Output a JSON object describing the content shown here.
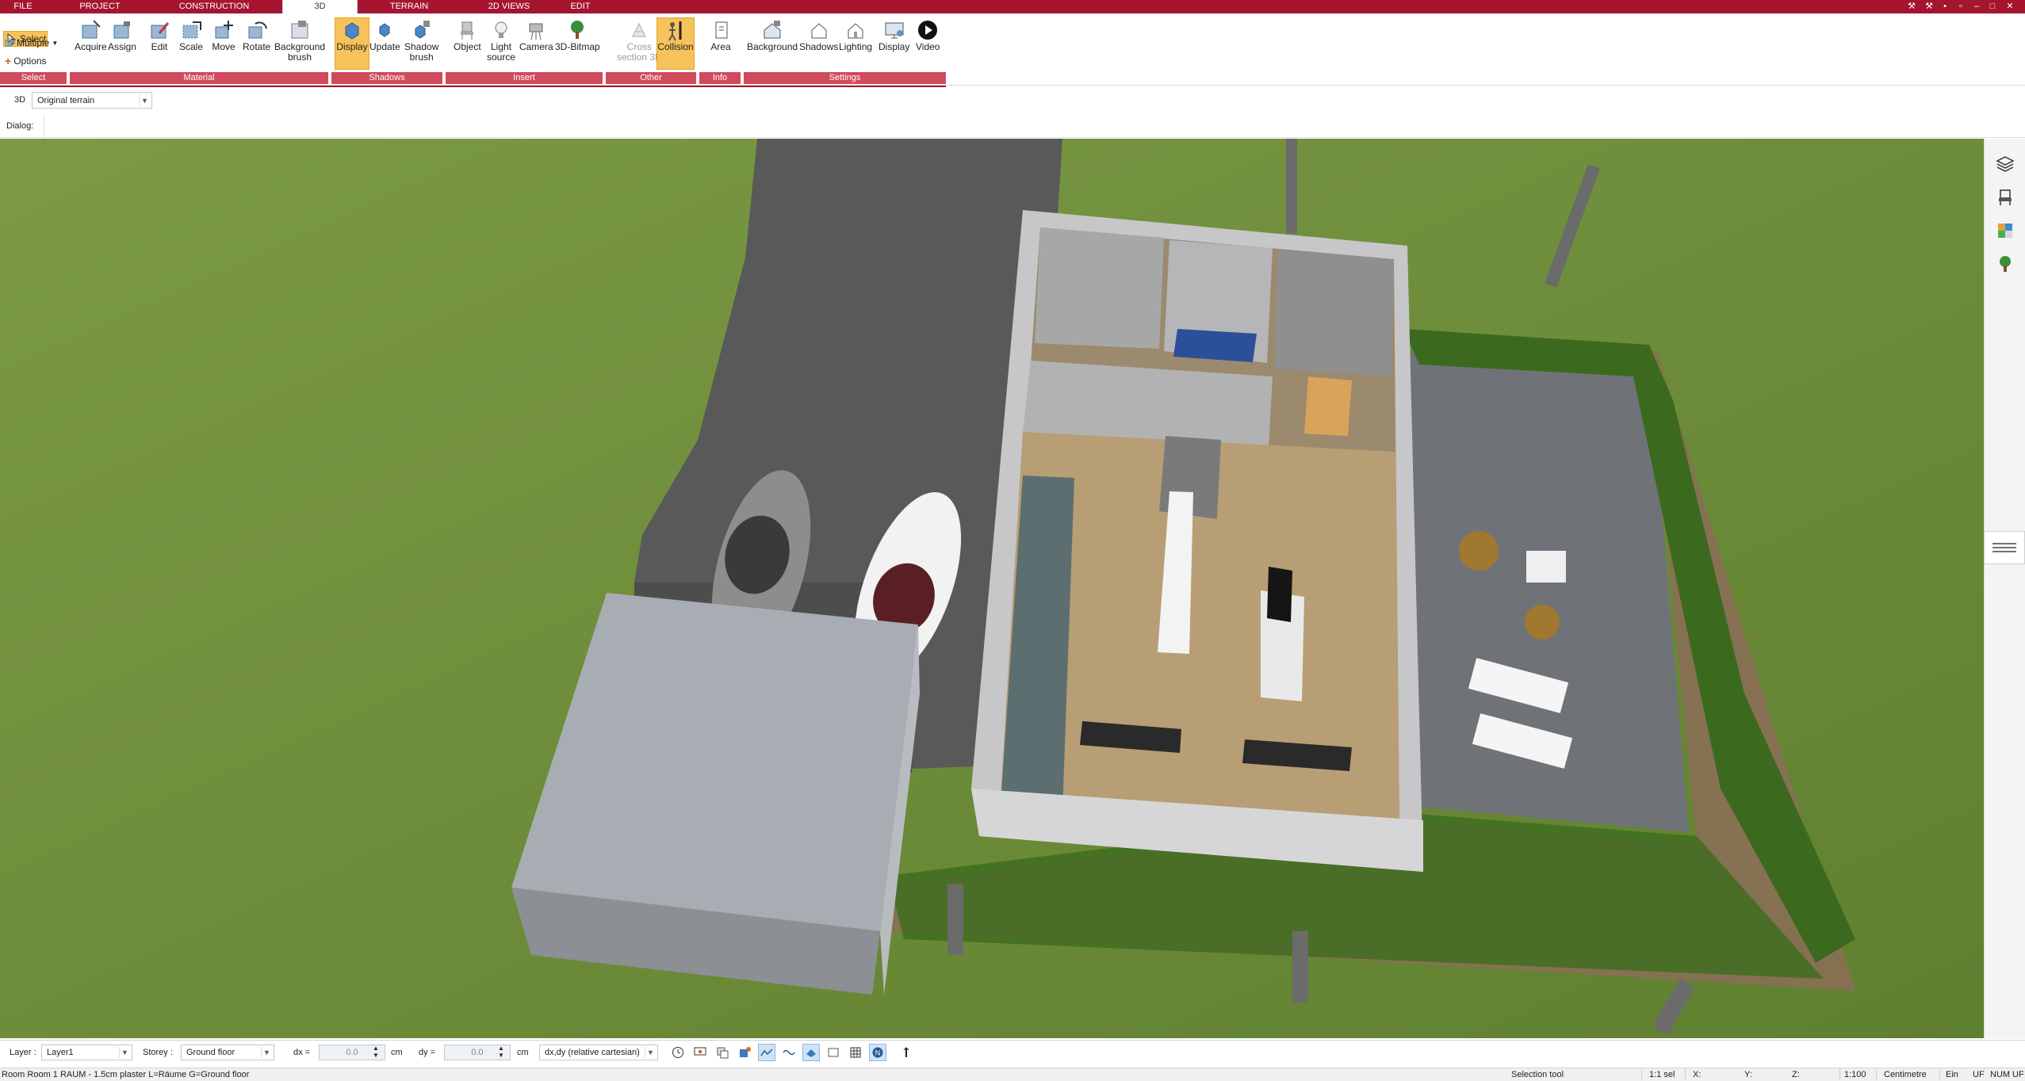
{
  "tabs": [
    {
      "label": "FILE",
      "active": false
    },
    {
      "label": "PROJECT",
      "active": false
    },
    {
      "label": "CONSTRUCTION",
      "active": false
    },
    {
      "label": "3D",
      "active": true
    },
    {
      "label": "TERRAIN",
      "active": false
    },
    {
      "label": "2D VIEWS",
      "active": false
    },
    {
      "label": "EDIT",
      "active": false
    }
  ],
  "ribbon": {
    "select": {
      "select_label": "Select",
      "multiple_label": "Multiple",
      "options_label": "Options",
      "group": "Select"
    },
    "material": {
      "group": "Material",
      "buttons": [
        "Acquire",
        "Assign",
        "Edit",
        "Scale",
        "Move",
        "Rotate",
        "Background",
        "brush"
      ]
    },
    "shadows": {
      "group": "Shadows",
      "buttons": [
        "Display",
        "Update",
        "Shadow",
        "brush"
      ]
    },
    "insert": {
      "group": "Insert",
      "buttons": [
        "Object",
        "Light",
        "source",
        "Camera",
        "3D-Bitmap"
      ]
    },
    "other": {
      "group": "Other",
      "buttons": [
        "Cross",
        "section 3D",
        "Collision"
      ]
    },
    "info": {
      "group": "Info",
      "buttons": [
        "Area"
      ]
    },
    "settings": {
      "group": "Settings",
      "buttons": [
        "Background",
        "Shadows",
        "Lighting",
        "Display",
        "Video"
      ]
    }
  },
  "view": {
    "mode": "3D",
    "terrain_option": "Original terrain",
    "dialog_label": "Dialog:"
  },
  "toolbar": {
    "layer_label": "Layer :",
    "layer_value": "Layer1",
    "storey_label": "Storey :",
    "storey_value": "Ground floor",
    "dx_label": "dx =",
    "dx_value": "0.0",
    "dx_unit": "cm",
    "dy_label": "dy =",
    "dy_value": "0.0",
    "dy_unit": "cm",
    "coord_mode": "dx,dy (relative cartesian)"
  },
  "status": {
    "description": "Room Room 1 RAUM - 1.5cm plaster L=Räume G=Ground floor",
    "tool": "Selection tool",
    "selection": "1:1 sel",
    "x": "X:",
    "y": "Y:",
    "z": "Z:",
    "scale": "1:100",
    "unit": "Centimetre",
    "ein": "Ein",
    "uf": "UF",
    "num": "NUM",
    "uf2": "UF"
  },
  "colors": {
    "accent": "#a5152f",
    "group_label": "#d14a5c",
    "active_button": "#f8c25a"
  }
}
